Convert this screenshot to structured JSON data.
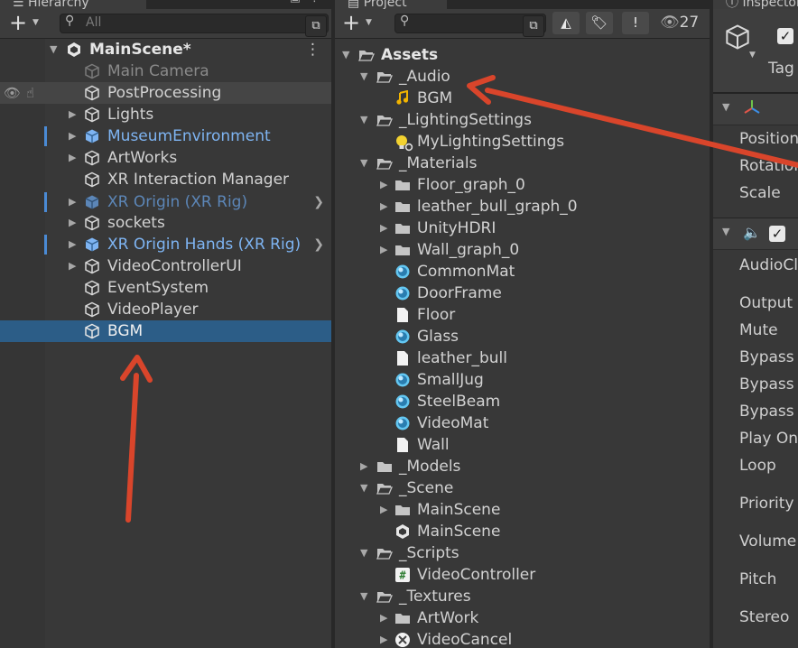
{
  "hierarchy": {
    "tab_title": "Hierarchy",
    "search_placeholder": "All",
    "scene_name": "MainScene*",
    "items": [
      {
        "label": "Main Camera"
      },
      {
        "label": "PostProcessing"
      },
      {
        "label": "Lights"
      },
      {
        "label": "MuseumEnvironment"
      },
      {
        "label": "ArtWorks"
      },
      {
        "label": "XR Interaction Manager"
      },
      {
        "label": "XR Origin (XR Rig)"
      },
      {
        "label": "sockets"
      },
      {
        "label": "XR Origin Hands (XR Rig)"
      },
      {
        "label": "VideoControllerUI"
      },
      {
        "label": "EventSystem"
      },
      {
        "label": "VideoPlayer"
      },
      {
        "label": "BGM"
      }
    ]
  },
  "project": {
    "tab_title": "Project",
    "visible_count": "27",
    "tree": [
      {
        "label": "Assets",
        "icon": "folder-open-icon"
      },
      {
        "label": "_Audio",
        "icon": "folder-open-icon"
      },
      {
        "label": "BGM",
        "icon": "audio-clip-icon"
      },
      {
        "label": "_LightingSettings",
        "icon": "folder-open-icon"
      },
      {
        "label": "MyLightingSettings",
        "icon": "lighting-settings-icon"
      },
      {
        "label": "_Materials",
        "icon": "folder-open-icon"
      },
      {
        "label": "Floor_graph_0",
        "icon": "folder-icon"
      },
      {
        "label": "leather_bull_graph_0",
        "icon": "folder-icon"
      },
      {
        "label": "UnityHDRI",
        "icon": "folder-icon"
      },
      {
        "label": "Wall_graph_0",
        "icon": "folder-icon"
      },
      {
        "label": "CommonMat",
        "icon": "material-icon"
      },
      {
        "label": "DoorFrame",
        "icon": "material-icon"
      },
      {
        "label": "Floor",
        "icon": "file-icon"
      },
      {
        "label": "Glass",
        "icon": "material-icon"
      },
      {
        "label": "leather_bull",
        "icon": "file-icon"
      },
      {
        "label": "SmallJug",
        "icon": "material-icon"
      },
      {
        "label": "SteelBeam",
        "icon": "material-icon"
      },
      {
        "label": "VideoMat",
        "icon": "material-icon"
      },
      {
        "label": "Wall",
        "icon": "file-icon"
      },
      {
        "label": "_Models",
        "icon": "folder-icon"
      },
      {
        "label": "_Scene",
        "icon": "folder-open-icon"
      },
      {
        "label": "MainScene",
        "icon": "folder-icon"
      },
      {
        "label": "MainScene",
        "icon": "unity-scene-icon"
      },
      {
        "label": "_Scripts",
        "icon": "folder-open-icon"
      },
      {
        "label": "VideoController",
        "icon": "csharp-script-icon"
      },
      {
        "label": "_Textures",
        "icon": "folder-open-icon"
      },
      {
        "label": "ArtWork",
        "icon": "folder-icon"
      },
      {
        "label": "VideoCancel",
        "icon": "texture-icon"
      }
    ]
  },
  "inspector": {
    "tab_title": "Inspector",
    "tag_label": "Tag",
    "transform_labels": [
      "Position",
      "Rotation",
      "Scale"
    ],
    "audio_labels": [
      "AudioClip",
      "Output",
      "Mute",
      "Bypass",
      "Bypass",
      "Bypass",
      "Play On",
      "Loop",
      "Priority",
      "Volume",
      "Pitch",
      "Stereo"
    ]
  },
  "colors": {
    "selection": "#2c5d87",
    "annotation_arrow": "#d9452b",
    "prefab_blue": "#7eb4f2"
  }
}
